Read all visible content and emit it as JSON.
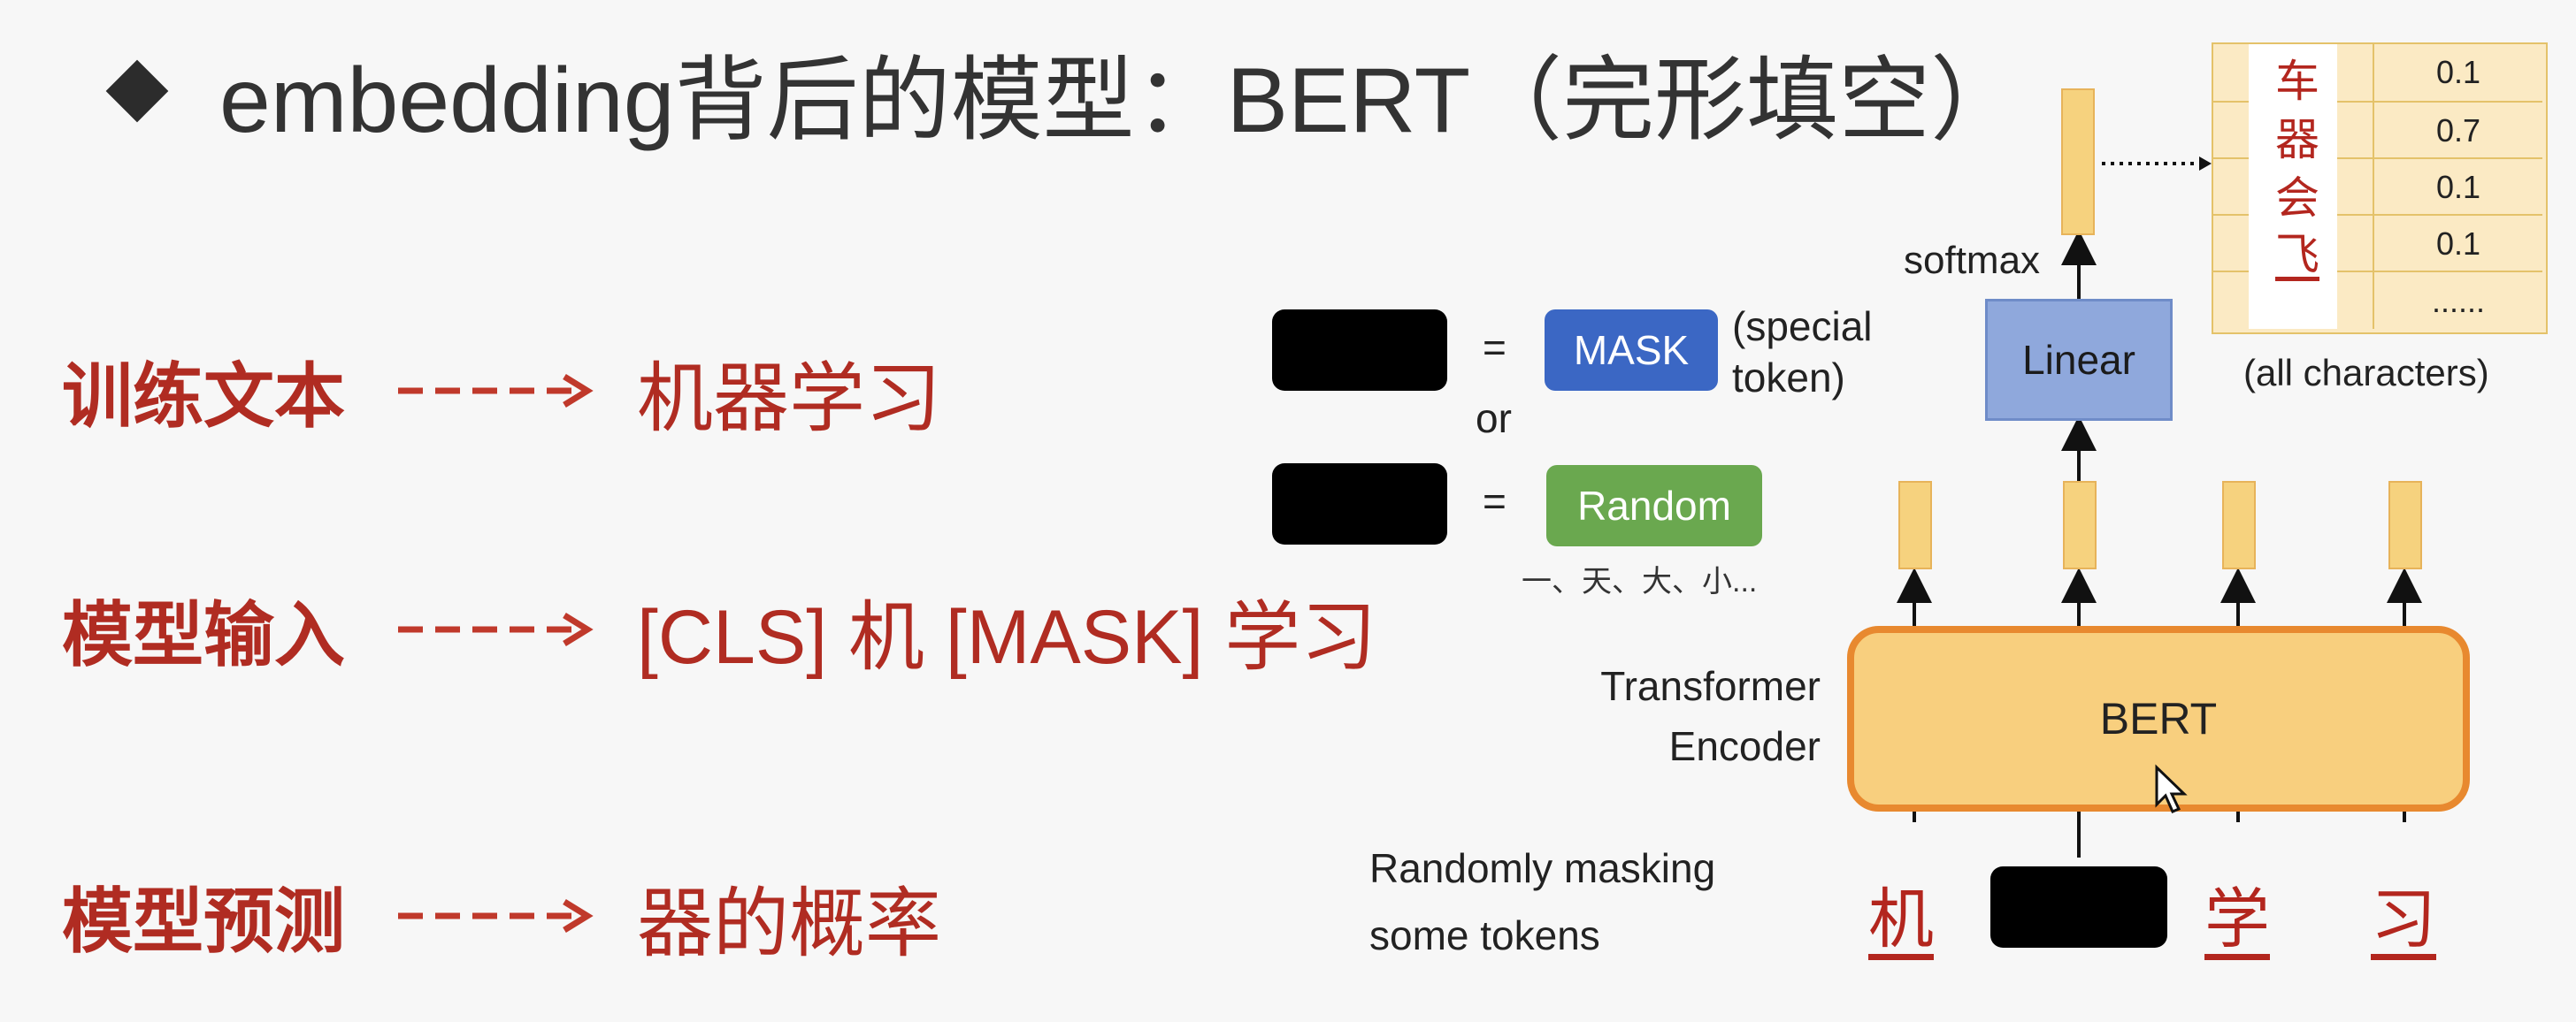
{
  "title": "embedding背后的模型：BERT（完形填空）",
  "rows": [
    {
      "label": "训练文本",
      "value": "机器学习"
    },
    {
      "label": "模型输入",
      "value": "[CLS] 机 [MASK] 学习"
    },
    {
      "label": "模型预测",
      "value": "器的概率"
    }
  ],
  "diagram": {
    "equals": "=",
    "or": "or",
    "mask_label": "MASK",
    "special_token": "(special\ntoken)",
    "random_label": "Random",
    "random_examples": "一、天、大、小...",
    "transformer_label": "Transformer\nEncoder",
    "bert_label": "BERT",
    "linear_label": "Linear",
    "softmax_label": "softmax",
    "masking_caption": "Randomly masking\nsome tokens",
    "input_chars": [
      "机",
      "学",
      "习"
    ],
    "output_chars": [
      "车",
      "器",
      "会",
      "飞"
    ],
    "output_probs": [
      "0.1",
      "0.7",
      "0.1",
      "0.1",
      "......"
    ],
    "all_characters": "(all characters)"
  },
  "colors": {
    "accent_red": "#b02c22",
    "mask_blue": "#3b67c4",
    "random_green": "#6aa84f",
    "bert_fill": "#f8cf7e",
    "bert_border": "#e8892f",
    "linear_fill": "#8fa8dc"
  }
}
